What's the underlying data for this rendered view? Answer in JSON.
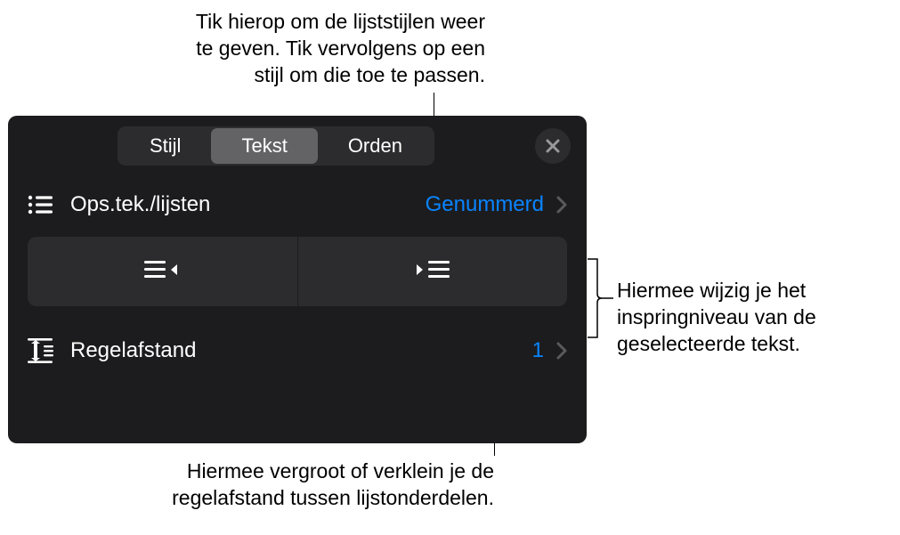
{
  "callouts": {
    "top": {
      "line1": "Tik hierop om de lijststijlen weer",
      "line2": "te geven. Tik vervolgens op een",
      "line3": "stijl om die toe te passen."
    },
    "right": {
      "line1": "Hiermee wijzig je het",
      "line2": "inspringniveau van de",
      "line3": "geselecteerde tekst."
    },
    "bottom": {
      "line1": "Hiermee vergroot of verklein je de",
      "line2": "regelafstand tussen lijstonderdelen."
    }
  },
  "panel": {
    "tabs": {
      "style": "Stijl",
      "text": "Tekst",
      "order": "Orden"
    },
    "lists": {
      "label": "Ops.tek./lijsten",
      "value": "Genummerd"
    },
    "linespacing": {
      "label": "Regelafstand",
      "value": "1"
    }
  }
}
